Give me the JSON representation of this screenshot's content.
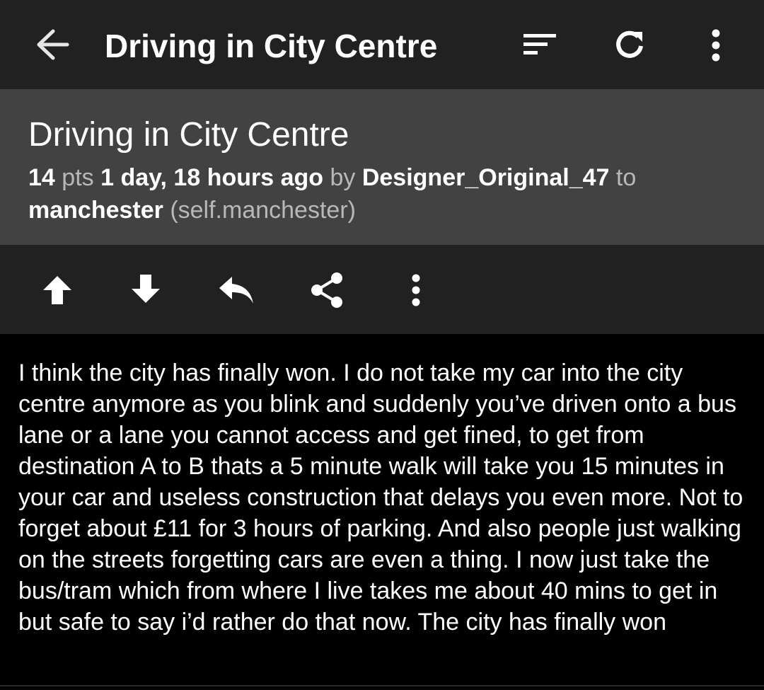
{
  "toolbar": {
    "title": "Driving in City Centre",
    "icons": [
      "arrow-left-icon",
      "sort-icon",
      "refresh-icon",
      "more-vertical-icon"
    ]
  },
  "post": {
    "title": "Driving in City Centre",
    "points": "14",
    "points_suffix": "pts",
    "time": "1 day, 18 hours ago",
    "by_label": "by",
    "author": "Designer_Original_47",
    "to_label": "to",
    "subreddit": "manchester",
    "domain": "(self.manchester)",
    "body": "I think the city has finally won. I do not take my car into the city centre anymore as you blink and suddenly you’ve driven onto a bus lane or a lane you cannot access and get fined, to get from destination A to B thats a 5 minute walk will take you 15 minutes in your car and useless construction that delays you even more. Not to forget about £11 for 3 hours of parking. And also people just walking on the streets forgetting cars are even a thing. I now just take the bus/tram which from where I live takes me about 40 mins to get in but safe to say i’d rather do that now. The city has finally won"
  },
  "actions": {
    "icons": [
      "upvote-icon",
      "downvote-icon",
      "reply-icon",
      "share-icon",
      "more-vertical-icon"
    ]
  },
  "colors": {
    "toolbar_bg": "#212121",
    "header_bg": "#424242",
    "body_bg": "#000000",
    "text_primary": "#ffffff",
    "text_secondary": "#b8b8b8"
  }
}
